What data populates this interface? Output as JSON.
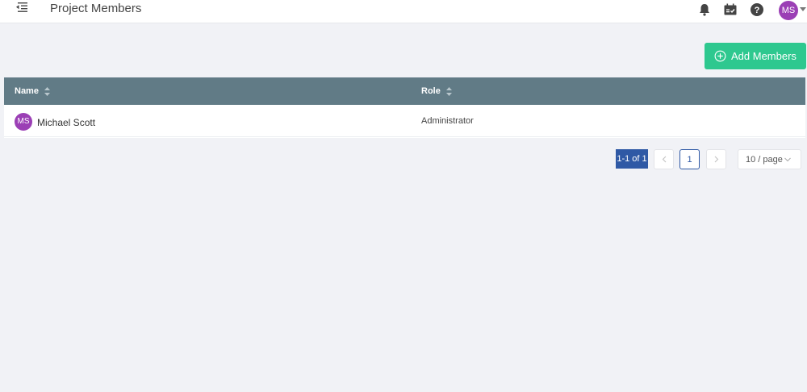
{
  "header": {
    "title": "Project Members",
    "user_initials": "MS",
    "icons": [
      "menu-collapse-icon",
      "bell-icon",
      "calendar-check-icon",
      "help-icon"
    ]
  },
  "actions": {
    "add_members_label": "Add Members"
  },
  "table": {
    "columns": [
      "Name",
      "Role"
    ],
    "rows": [
      {
        "initials": "MS",
        "name": "Michael Scott",
        "role": "Administrator"
      }
    ]
  },
  "pagination": {
    "range_text": "1-1 of 1",
    "current_page": "1",
    "page_size": "10 / page"
  },
  "colors": {
    "accent_green": "#2ec88f",
    "table_header": "#617b86",
    "avatar": "#9b3fb5",
    "pagination_blue": "#2f59a5"
  }
}
